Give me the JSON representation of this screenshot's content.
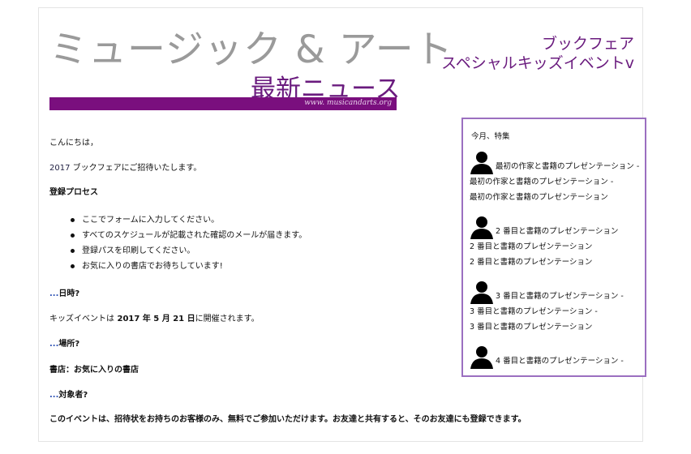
{
  "header": {
    "brand": "ミュージック & アート",
    "news_title": "最新ニュース",
    "site": "www. musicandarts.org",
    "event_line1": "ブックフェア",
    "event_line2": "スペシャルキッズイベントv"
  },
  "body": {
    "greeting": "こんにちは，",
    "invite_year": "2017",
    "invite_text": " ブックフェアにご招待いたします。",
    "registration_heading": "登録プロセス",
    "steps": [
      "ここでフォームに入力してください。",
      "すべてのスケジュールが記載された確認のメールが届きます。",
      "登録パスを印刷してください。",
      "お気に入りの書店でお待ちしています!"
    ],
    "ellipsis": "...",
    "when_heading": "日時?",
    "held_prefix": "キッズイベントは",
    "held_date": " 2017 年 5 月 21 日",
    "held_suffix": "に開催されます。",
    "where_heading": "場所?",
    "store": "書店：お気に入りの書店",
    "who_heading": "対象者?",
    "note": "このイベントは、招待状をお持ちのお客様のみ、無料でご参加いただけます。お友達と共有すると、そのお友達にも登録できます。"
  },
  "sidebar": {
    "title": "今月、特集",
    "icon": "person-silhouette-icon",
    "events": [
      {
        "line1": "最初の作家と書籍のプレゼンテーション -",
        "line2": "最初の作家と書籍のプレゼンテーション -",
        "line3": "最初の作家と書籍のプレゼンテーション"
      },
      {
        "line1": "2 番目と書籍のプレゼンテーション",
        "line2": "2 番目と書籍のプレゼンテーション",
        "line3": "2 番目と書籍のプレゼンテーション"
      },
      {
        "line1": "3 番目と書籍のプレゼンテーション -",
        "line2": "3 番目と書籍のプレゼンテーション -",
        "line3": "3 番目と書籍のプレゼンテーション"
      },
      {
        "line1": "4 番目と書籍のプレゼンテーション -",
        "line2": "",
        "line3": ""
      }
    ]
  },
  "colors": {
    "brand_gray": "#9a9a9a",
    "accent_purple": "#6a1b7e",
    "banner_purple": "#7a0f7e",
    "sidebar_border": "#9b6fc0"
  }
}
